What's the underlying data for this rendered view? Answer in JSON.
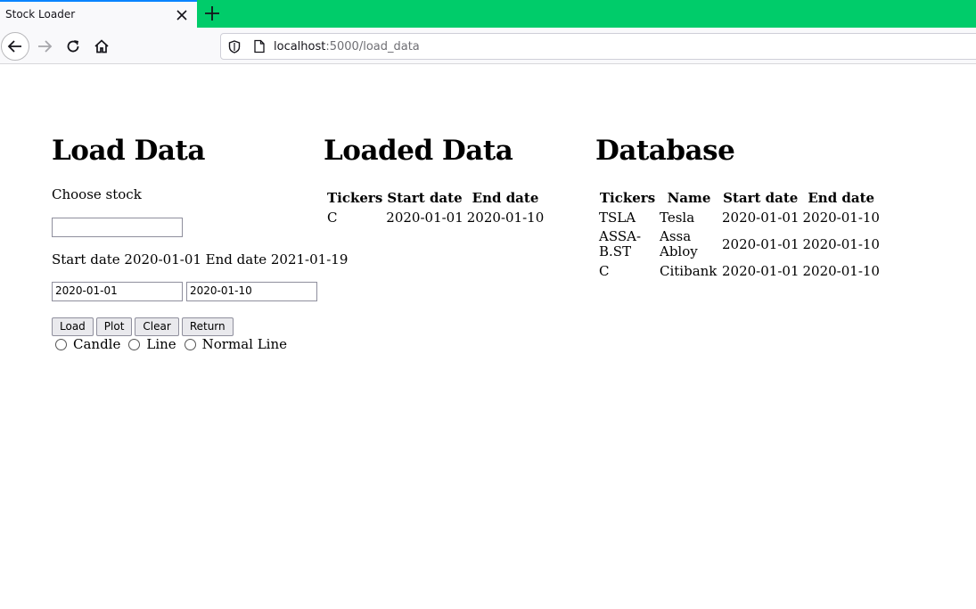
{
  "browser": {
    "tab_title": "Stock Loader",
    "url_host": "localhost",
    "url_rest": ":5000/load_data",
    "icons": {
      "tab_close": "close-icon",
      "new_tab": "plus-icon",
      "back": "arrow-left-icon",
      "forward": "arrow-right-icon",
      "reload": "reload-icon",
      "home": "home-icon",
      "shield": "shield-icon",
      "page": "page-icon"
    },
    "colors": {
      "tabbar": "#00cc6a",
      "active_tab_accent": "#0a84ff"
    }
  },
  "load": {
    "title": "Load Data",
    "choose_label": "Choose stock",
    "stock_value": "",
    "date_range_text": "Start date 2020-01-01 End date 2021-01-19",
    "start_date": "2020-01-01",
    "end_date": "2020-01-10",
    "buttons": {
      "load": "Load",
      "plot": "Plot",
      "clear": "Clear",
      "return": "Return"
    },
    "radios": [
      "Candle",
      "Line",
      "Normal Line"
    ]
  },
  "loaded": {
    "title": "Loaded Data",
    "headers": [
      "Tickers",
      "Start date",
      "End date"
    ],
    "rows": [
      [
        "C",
        "2020-01-01",
        "2020-01-10"
      ]
    ]
  },
  "database": {
    "title": "Database",
    "headers": [
      "Tickers",
      "Name",
      "Start date",
      "End date"
    ],
    "rows": [
      {
        "ticker_1": "TSLA",
        "ticker_2": "",
        "name_1": "Tesla",
        "name_2": "",
        "start": "2020-01-01",
        "end": "2020-01-10"
      },
      {
        "ticker_1": "ASSA-",
        "ticker_2": "B.ST",
        "name_1": "Assa",
        "name_2": "Abloy",
        "start": "2020-01-01",
        "end": "2020-01-10"
      },
      {
        "ticker_1": "C",
        "ticker_2": "",
        "name_1": "Citibank",
        "name_2": "",
        "start": "2020-01-01",
        "end": "2020-01-10"
      }
    ]
  }
}
